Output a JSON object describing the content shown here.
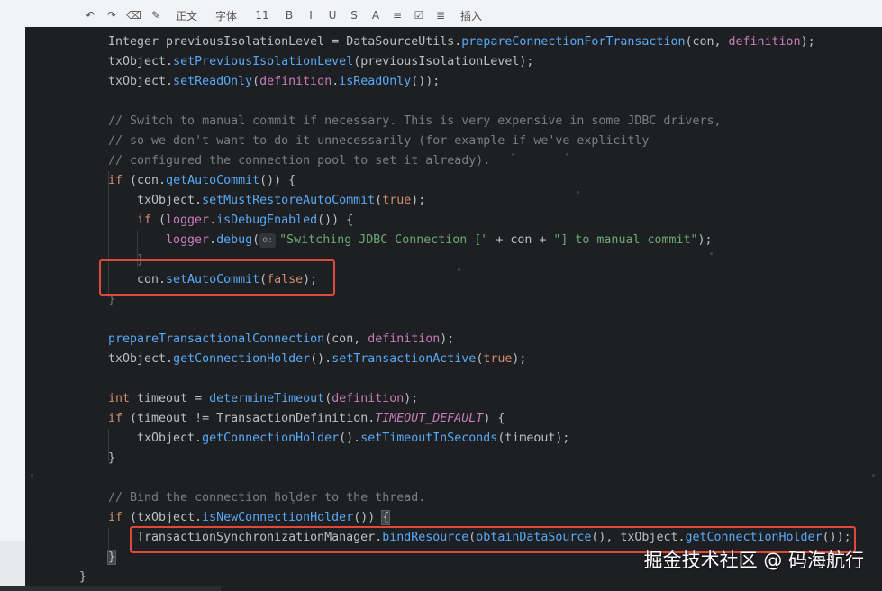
{
  "background_toolbar": {
    "items": [
      "↶",
      "↷",
      "⌫",
      "✎",
      "正文",
      "字体",
      "11",
      "B",
      "I",
      "U",
      "S",
      "A",
      "≡",
      "☑",
      "≣",
      "插入"
    ]
  },
  "code_lines": {
    "l1": {
      "type": "Integer",
      "var": " previousIsolationLevel = ",
      "cls": "DataSourceUtils",
      "dot": ".",
      "fn": "prepareConnectionForTransaction",
      "args_open": "(con, ",
      "param": "definition",
      "end": ");"
    },
    "l2": {
      "obj": "txObject.",
      "fn": "setPreviousIsolationLevel",
      "rest": "(previousIsolationLevel);"
    },
    "l3": {
      "obj": "txObject.",
      "fn": "setReadOnly",
      "p1": "(",
      "param": "definition",
      "dot": ".",
      "fn2": "isReadOnly",
      "end": "());"
    },
    "c1": "// Switch to manual commit if necessary. This is very expensive in some JDBC drivers,",
    "c2": "// so we don't want to do it unnecessarily (for example if we've explicitly",
    "c3": "// configured the connection pool to set it already).",
    "l4": {
      "kw": "if",
      "open": " (con.",
      "fn": "getAutoCommit",
      "end": "()) {"
    },
    "l5": {
      "obj": "txObject.",
      "fn": "setMustRestoreAutoCommit",
      "p": "(",
      "kw": "true",
      "end": ");"
    },
    "l6": {
      "kw": "if",
      "open": " (",
      "param": "logger",
      "dot": ".",
      "fn": "isDebugEnabled",
      "end": "()) {"
    },
    "l7": {
      "param": "logger",
      "dot": ".",
      "fn": "debug",
      "p": "(",
      "hint": "o:",
      "str": "\"Switching JDBC Connection [\"",
      "mid": " + con + ",
      "str2": "\"] to manual commit\"",
      "end": ");"
    },
    "l8": "}",
    "l9": {
      "obj": "con.",
      "fn": "setAutoCommit",
      "p": "(",
      "kw": "false",
      "end": ");"
    },
    "l10": "}",
    "l11": {
      "fn": "prepareTransactionalConnection",
      "p": "(con, ",
      "param": "definition",
      "end": ");"
    },
    "l12": {
      "obj": "txObject.",
      "fn": "getConnectionHolder",
      "mid": "().",
      "fn2": "setTransactionActive",
      "p": "(",
      "kw": "true",
      "end": ");"
    },
    "l13": {
      "kw": "int",
      "var": " timeout = ",
      "fn": "determineTimeout",
      "p": "(",
      "param": "definition",
      "end": ");"
    },
    "l14": {
      "kw": "if",
      "open": " (timeout != ",
      "cls": "TransactionDefinition",
      "dot": ".",
      "cst": "TIMEOUT_DEFAULT",
      "end": ") {"
    },
    "l15": {
      "obj": "txObject.",
      "fn": "getConnectionHolder",
      "mid": "().",
      "fn2": "setTimeoutInSeconds",
      "end": "(timeout);"
    },
    "l16": "}",
    "c4": "// Bind the connection holder to the thread.",
    "l17": {
      "kw": "if",
      "open": " (txObject.",
      "fn": "isNewConnectionHolder",
      "mid": "()) ",
      "brace": "{"
    },
    "l18": {
      "cls": "TransactionSynchronizationManager",
      "dot": ".",
      "fn": "bindResource",
      "p": "(",
      "fn2": "obtainDataSource",
      "mid": "(), txObject.",
      "fn3": "getConnectionHolder",
      "end": "());"
    },
    "l19": "}",
    "l20": "}"
  },
  "watermark": "掘金技术社区 @ 码海航行",
  "colors": {
    "editor_bg": "#1e1f22",
    "keyword": "#cf8e6d",
    "method": "#57aaf7",
    "field": "#c77dbb",
    "string": "#6aab73",
    "comment": "#7a7e85",
    "highlight_box": "#e0483a"
  }
}
